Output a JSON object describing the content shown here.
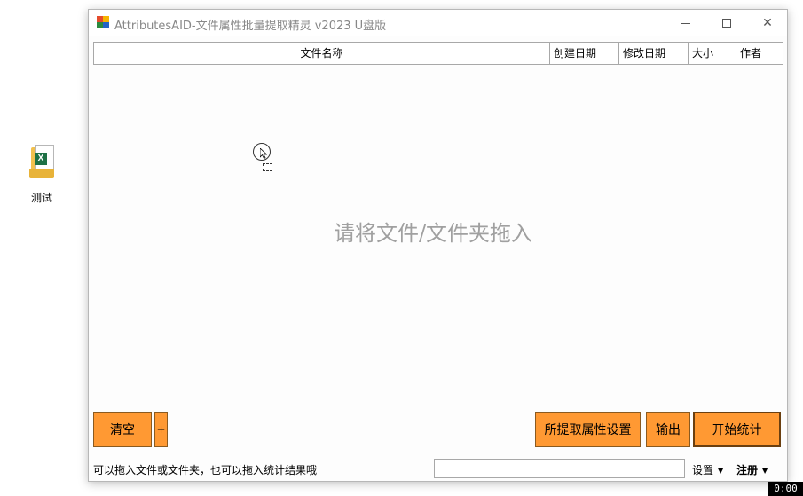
{
  "desktop": {
    "icon_label": "测试",
    "icon_name": "excel-folder-icon"
  },
  "window": {
    "title": "AttributesAID-文件属性批量提取精灵 v2023 U盘版",
    "controls": {
      "minimize": "minimize-icon",
      "maximize": "maximize-icon",
      "close": "close-icon",
      "close_glyph": "✕"
    }
  },
  "file_list": {
    "columns": [
      "文件名称",
      "创建日期",
      "修改日期",
      "大小",
      "作者"
    ],
    "drop_hint": "请将文件/文件夹拖入"
  },
  "buttons": {
    "clear": "清空",
    "plus": "+",
    "attr_settings": "所提取属性设置",
    "output": "输出",
    "start": "开始统计"
  },
  "status": {
    "hint": "可以拖入文件或文件夹，也可以拖入统计结果哦",
    "field_value": "",
    "settings": "设置",
    "register": "注册",
    "caret": "▼"
  },
  "recording_timer": "0:00",
  "colors": {
    "button_orange": "#ff9933",
    "drop_hint_gray": "#a0a0a0",
    "title_gray": "#888888"
  }
}
